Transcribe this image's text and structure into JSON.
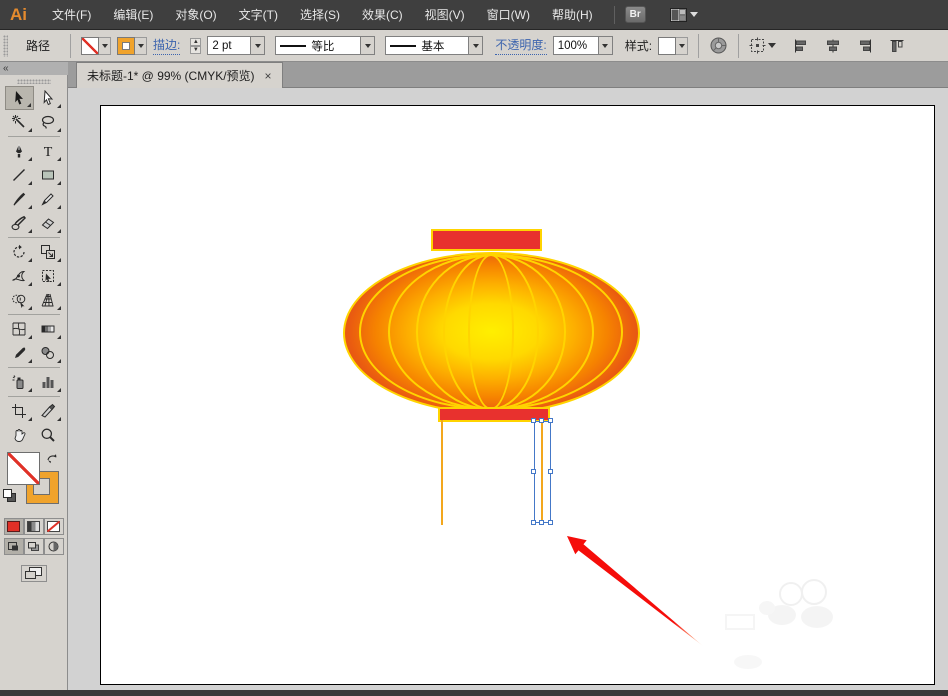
{
  "menu_bar": {
    "logo": "Ai",
    "items": [
      "文件(F)",
      "编辑(E)",
      "对象(O)",
      "文字(T)",
      "选择(S)",
      "效果(C)",
      "视图(V)",
      "窗口(W)",
      "帮助(H)"
    ],
    "bridge_label": "Br",
    "workspace_icon": "workspace-switcher-icon"
  },
  "control_bar": {
    "context_label": "路径",
    "fill_swatch": "none",
    "stroke_swatch": "gold",
    "stroke_label": "描边:",
    "stroke_weight": "2 pt",
    "width_profile_label": "等比",
    "brush_label": "基本",
    "opacity_label": "不透明度:",
    "opacity_value": "100%",
    "style_label": "样式:",
    "icons": [
      "recolor-artwork-icon",
      "transform-reference-icon",
      "align-left-icon",
      "align-center-icon",
      "align-right-icon",
      "align-top-icon"
    ]
  },
  "tab": {
    "title": "未标题-1* @ 99% (CMYK/预览)",
    "close_label": "×"
  },
  "dock": {
    "collapse_label": "«"
  },
  "toolbar": {
    "tools": [
      "selection",
      "direct-selection",
      "magic-wand",
      "lasso",
      "pen",
      "type",
      "line-segment",
      "rectangle",
      "paintbrush",
      "pencil",
      "blob-brush",
      "eraser",
      "rotate",
      "scale",
      "width",
      "free-transform",
      "shape-builder",
      "perspective-grid",
      "mesh",
      "gradient",
      "eyedropper",
      "blend",
      "symbol-sprayer",
      "column-graph",
      "artboard",
      "slice",
      "hand",
      "zoom"
    ],
    "active_tool": "selection",
    "type_tool_glyph": "T",
    "fill_indicator": "none",
    "stroke_indicator": "gold"
  },
  "colors": {
    "menu_bg": "#3f3f3f",
    "logo_orange": "#e58b2e",
    "bar_bg": "#d6d3ce",
    "tabstrip_bg": "#9c9c9c",
    "pasteboard": "#d2d2d2",
    "link_blue": "#3c64ae",
    "gold": "#f0a32c",
    "lantern_yellow": "#ffd400",
    "lantern_center": "#ffef00",
    "lantern_edge": "#e35318",
    "cap_red": "#e8312e",
    "string_orange": "#f3a71d",
    "selection_blue": "#4478c8",
    "arrow_red": "#f50d0a"
  },
  "artwork": {
    "description": "red-gold Chinese lantern with radial gradient body, rib lines, red caps, hanging strings",
    "selected_object": "tassel string with blue bounding box and 8 anchor handles",
    "annotation": "red arrow pointing at selected string"
  }
}
